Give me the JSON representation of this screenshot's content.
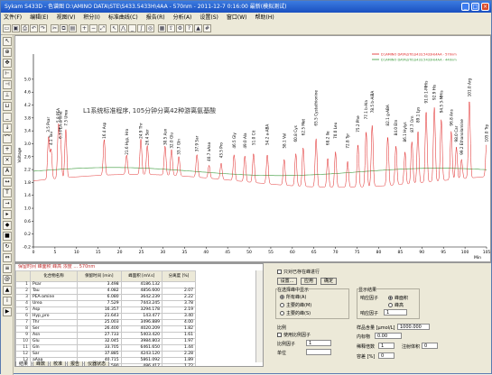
{
  "window": {
    "title": "Sykam S433D - 色谱图 D:\\AMINO DATA\\STE\\S433.5433H\\4AA - 570nm - 2011-12-7 0:16:00 最新(模拟测试)",
    "min": "_",
    "max": "□",
    "close": "×"
  },
  "menu": [
    "文件(F)",
    "编辑(E)",
    "视图(V)",
    "积分(I)",
    "标准曲线(C)",
    "报告(R)",
    "分析(A)",
    "设置(S)",
    "窗口(W)",
    "帮助(H)"
  ],
  "toolbar_icons": [
    "open-icon",
    "save-icon",
    "print-icon",
    "undo-icon",
    "redo-icon",
    "cut-icon",
    "copy-icon",
    "paste-icon",
    "zoom-in-icon",
    "zoom-out-icon",
    "zoom-fit-icon",
    "cursor-icon",
    "peak-icon",
    "baseline-icon",
    "integrate-icon",
    "calibrate-icon",
    "report-icon",
    "export-icon",
    "settings-icon",
    "help-icon",
    "lock-icon",
    "grid-icon"
  ],
  "left_tool_icons": [
    "select-icon",
    "zoom-icon",
    "pan-icon",
    "peak-start-icon",
    "peak-end-icon",
    "split-icon",
    "merge-icon",
    "baseline-icon",
    "drop-icon",
    "tangent-icon",
    "add-peak-icon",
    "delete-peak-icon",
    "label-icon",
    "measure-icon",
    "text-icon",
    "arrow-icon",
    "cursor-icon",
    "mark-icon",
    "stop-icon",
    "refresh-icon",
    "range-icon",
    "scale-icon",
    "auto-icon",
    "lock-icon",
    "info-icon",
    "run-icon"
  ],
  "chart_data": {
    "type": "line",
    "title": "L1系统标准程序, 105分钟分离42种游离氨基酸",
    "legend": [
      "D:\\AMINO DATA\\STE\\S433.5433H\\4AA - 570nm",
      "D:\\AMINO DATA\\STE\\S433.5433H\\4AA - 440nm"
    ],
    "legend_placement": "top-right",
    "ylabel": "Voltage",
    "xlabel": "Min",
    "ylim": [
      -0.2,
      5.5
    ],
    "xlim": [
      0,
      105
    ],
    "y_ticks": [
      "5.0",
      "4.6",
      "4.2",
      "3.8",
      "3.4",
      "3.0",
      "2.6",
      "2.2",
      "1.8",
      "1.4",
      "1.0",
      "0.6",
      "0.2",
      "-0.2"
    ],
    "x_ticks": [
      "0",
      "5",
      "10",
      "15",
      "20",
      "25",
      "30",
      "35",
      "40",
      "45",
      "50",
      "55",
      "60",
      "65",
      "70",
      "75",
      "80",
      "85",
      "90",
      "95",
      "100",
      "105"
    ],
    "series": [
      {
        "name": "D:\\AMINO DATA\\STE\\S433.5433H\\4AA - 570nm",
        "color": "#e02020",
        "peaks": [
          {
            "t": 3.5,
            "h": 3.3,
            "label": "3.5 Psar"
          },
          {
            "t": 4.1,
            "h": 2.9,
            "label": "4.1 Tau"
          },
          {
            "t": 5.8,
            "h": 3.6,
            "label": "5.8 PEA"
          },
          {
            "t": 6.3,
            "h": 3.1,
            "label": "6.3 PEA-amine"
          },
          {
            "t": 7.5,
            "h": 3.5,
            "label": "7.5 Urea"
          },
          {
            "t": 16.4,
            "h": 3.1,
            "label": "16.4 Asp"
          },
          {
            "t": 21.6,
            "h": 2.6,
            "label": "21.6 Hyp, Hro"
          },
          {
            "t": 24.9,
            "h": 3.1,
            "label": "24.9 Thr"
          },
          {
            "t": 26.4,
            "h": 2.9,
            "label": "26.4 Ser"
          },
          {
            "t": 30.5,
            "h": 2.9,
            "label": "30.5 Asn"
          },
          {
            "t": 32.0,
            "h": 2.8,
            "label": "32.0 Glu"
          },
          {
            "t": 33.7,
            "h": 2.6,
            "label": "33.7 Gln"
          },
          {
            "t": 37.9,
            "h": 2.7,
            "label": "37.9 Sar"
          },
          {
            "t": 40.7,
            "h": 2.4,
            "label": "40.7 aAaa"
          },
          {
            "t": 43.5,
            "h": 2.5,
            "label": "43.5 Pro"
          },
          {
            "t": 46.5,
            "h": 2.8,
            "label": "46.5 Gly"
          },
          {
            "t": 49.0,
            "h": 2.8,
            "label": "49.0 Ala"
          },
          {
            "t": 51.0,
            "h": 2.9,
            "label": "51.0 Cit"
          },
          {
            "t": 54.2,
            "h": 2.9,
            "label": "54.2 a-ABA"
          },
          {
            "t": 58.1,
            "h": 2.8,
            "label": "58.1 Val"
          },
          {
            "t": 60.8,
            "h": 3.0,
            "label": "60.8 Cys"
          },
          {
            "t": 62.5,
            "h": 3.2,
            "label": "62.5 Met"
          },
          {
            "t": 65.5,
            "h": 3.5,
            "label": "65.5 Cystathionine"
          },
          {
            "t": 68.2,
            "h": 2.9,
            "label": "68.2 Ile"
          },
          {
            "t": 70.0,
            "h": 3.1,
            "label": "70.0 Leu"
          },
          {
            "t": 72.8,
            "h": 2.8,
            "label": "72.8 Tyr"
          },
          {
            "t": 75.2,
            "h": 3.3,
            "label": "75.2 Phe"
          },
          {
            "t": 77.1,
            "h": 3.7,
            "label": "77.1 b-Ala"
          },
          {
            "t": 78.5,
            "h": 3.9,
            "label": "78.5 b-AiBA"
          },
          {
            "t": 82.1,
            "h": 3.5,
            "label": "82.1 g-ABA"
          },
          {
            "t": 84.0,
            "h": 3.2,
            "label": "84.0 Etn"
          },
          {
            "t": 86.1,
            "h": 3.0,
            "label": "86.1 Hylys"
          },
          {
            "t": 87.7,
            "h": 3.3,
            "label": "87.7 Orn"
          },
          {
            "t": 89.1,
            "h": 3.6,
            "label": "89.1 Lys"
          },
          {
            "t": 91.0,
            "h": 4.2,
            "label": "91.0 1-MHis"
          },
          {
            "t": 92.9,
            "h": 4.3,
            "label": "92.9 His"
          },
          {
            "t": 94.5,
            "h": 3.9,
            "label": "94.5 3-MHis"
          },
          {
            "t": 96.8,
            "h": 3.5,
            "label": "96.8 Ans"
          },
          {
            "t": 98.0,
            "h": 3.0,
            "label": "98.0 Car"
          },
          {
            "t": 99.2,
            "h": 2.6,
            "label": "99.2 Ethanolamine"
          },
          {
            "t": 101.0,
            "h": 4.4,
            "label": "101.0 Arg"
          },
          {
            "t": 105.0,
            "h": 3.0,
            "label": "105.0 Trp"
          }
        ]
      },
      {
        "name": "D:\\AMINO DATA\\STE\\S433.5433H\\4AA - 440nm",
        "color": "#3a9a3a"
      }
    ]
  },
  "results": {
    "header_text": "保留时间 峰面积 峰高 浓度 ... 570nm",
    "columns": [
      "",
      "化合物名称",
      "保留时间\n[min]",
      "峰面积\n[mV.s]",
      "分离度\n[%]"
    ],
    "rows": [
      [
        "1",
        "Psar",
        "3.498",
        "4186.132",
        ""
      ],
      [
        "2",
        "Tau",
        "4.082",
        "4856.600",
        "2.07"
      ],
      [
        "3",
        "PEA-amine",
        "6.080",
        "3642.239",
        "2.22"
      ],
      [
        "4",
        "Urea",
        "7.529",
        "7443.245",
        "3.78"
      ],
      [
        "5",
        "Asp",
        "16.357",
        "3294.178",
        "2.19"
      ],
      [
        "6",
        "Hyp_pro",
        "21.643",
        "143.477",
        "3.40"
      ],
      [
        "7",
        "Thr",
        "25.003",
        "3496.889",
        "4.00"
      ],
      [
        "8",
        "Ser",
        "26.400",
        "4020.209",
        "1.82"
      ],
      [
        "9",
        "Asn",
        "27.733",
        "5403.420",
        "1.61"
      ],
      [
        "10",
        "Glu",
        "32.045",
        "3984.803",
        "1.97"
      ],
      [
        "11",
        "Gln",
        "33.705",
        "6461.650",
        "1.44"
      ],
      [
        "12",
        "Sar",
        "37.885",
        "4243.120",
        "2.28"
      ],
      [
        "13",
        "aAaa",
        "40.715",
        "5861.092",
        "1.89"
      ],
      [
        "14",
        "Pro",
        "43.590",
        "486.417",
        "1.72"
      ],
      [
        "15",
        "Gly",
        "46.453",
        "3928.330",
        "1.60"
      ],
      [
        "16",
        "Ala",
        "49.015",
        "6321.408",
        "2.08"
      ],
      [
        "17",
        "Cit",
        "51.012",
        "3710.402",
        "1.44"
      ]
    ],
    "tabs": [
      "结果",
      "峰数",
      "校准",
      "报告",
      "仪器状态"
    ]
  },
  "panel": {
    "checkbox_show_baseline": "只对已存在峰进行",
    "btn_settings": "设置...",
    "btn_apply": "应用",
    "btn_ok": "确定",
    "group_peak_label": "在选择峰中显示",
    "radio_all": "所有峰(A)",
    "radio_main": "主要的峰(M)",
    "radio_sel": "主要的峰(S)",
    "group_right_label": "显示结果",
    "ctl_resp": "响应因子",
    "ctl_peak_area": "峰面积",
    "ctl_peak_height": "峰高",
    "ctl_factor": "响应因子",
    "ctl_factor_val": "1",
    "row_ratio": "比例",
    "row_use_ratio": "使用比例因子",
    "row_ratio_factor": "比例因子",
    "row_unit": "单位",
    "ratio_val": "1",
    "sample_amount": "样品含量 [µmol/L]",
    "sample_amount_val": "1000.000",
    "internal_std": "内标物",
    "dilution": "稀释倍数",
    "dilution_val": "1",
    "vol_label": "注射体积",
    "vol_val": "0",
    "zero": "0.00",
    "tol": "容差 [%]",
    "tol_val": "0"
  }
}
